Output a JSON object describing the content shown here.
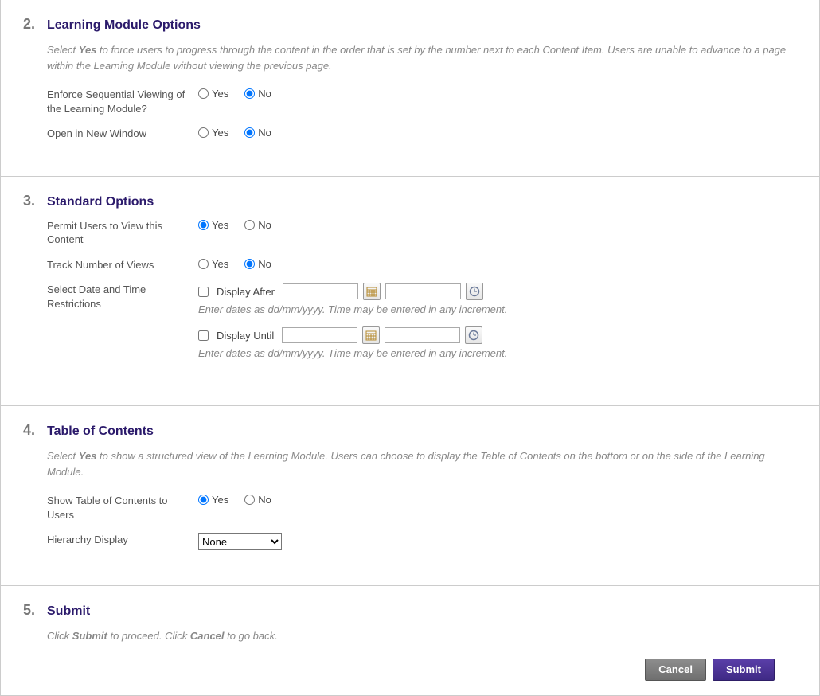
{
  "common": {
    "yes": "Yes",
    "no": "No"
  },
  "section2": {
    "num": "2.",
    "title": "Learning Module Options",
    "desc_before": "Select ",
    "desc_bold": "Yes",
    "desc_after": " to force users to progress through the content in the order that is set by the number next to each Content Item. Users are unable to advance to a page within the Learning Module without viewing the previous page.",
    "enforce_label": "Enforce Sequential Viewing of the Learning Module?",
    "open_label": "Open in New Window"
  },
  "section3": {
    "num": "3.",
    "title": "Standard Options",
    "permit_label": "Permit Users to View this Content",
    "track_label": "Track Number of Views",
    "restrict_label": "Select Date and Time Restrictions",
    "display_after": "Display After",
    "display_until": "Display Until",
    "date_hint": "Enter dates as dd/mm/yyyy. Time may be entered in any increment."
  },
  "section4": {
    "num": "4.",
    "title": "Table of Contents",
    "desc_before": "Select ",
    "desc_bold": "Yes",
    "desc_after": " to show a structured view of the Learning Module. Users can choose to display the Table of Contents on the bottom or on the side of the Learning Module.",
    "show_toc_label": "Show Table of Contents to Users",
    "hierarchy_label": "Hierarchy Display",
    "hierarchy_selected": "None"
  },
  "section5": {
    "num": "5.",
    "title": "Submit",
    "desc_before": "Click ",
    "desc_bold1": "Submit",
    "desc_mid": " to proceed. Click ",
    "desc_bold2": "Cancel",
    "desc_after": " to go back."
  },
  "buttons": {
    "cancel": "Cancel",
    "submit": "Submit"
  }
}
